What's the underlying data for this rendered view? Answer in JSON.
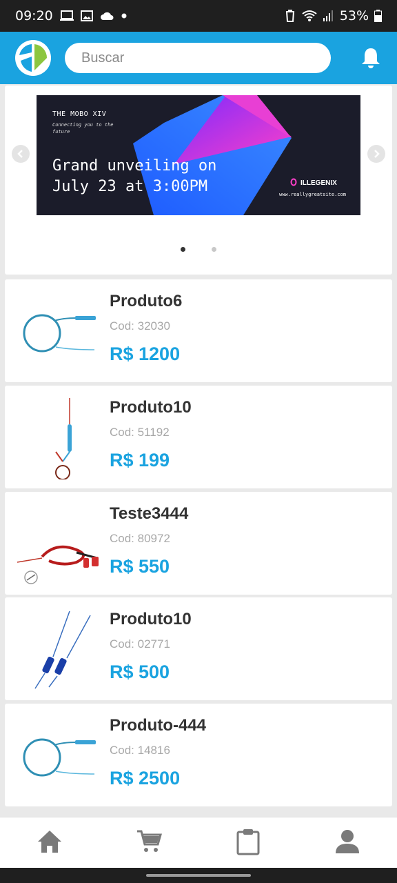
{
  "status": {
    "time": "09:20",
    "battery": "53%"
  },
  "header": {
    "search_placeholder": "Buscar"
  },
  "banner": {
    "title": "THE MOBO XIV",
    "subtitle": "Connecting you to the future",
    "headline": "Grand unveiling on July 23 at 3:00PM",
    "brand": "ILLEGENIX",
    "site": "www.reallygreatsite.com"
  },
  "products": [
    {
      "name": "Produto6",
      "code": "Cod: 32030",
      "price": "R$ 1200"
    },
    {
      "name": "Produto10",
      "code": "Cod: 51192",
      "price": "R$ 199"
    },
    {
      "name": "Teste3444",
      "code": "Cod: 80972",
      "price": "R$ 550"
    },
    {
      "name": "Produto10",
      "code": "Cod: 02771",
      "price": "R$ 500"
    },
    {
      "name": "Produto-444",
      "code": "Cod: 14816",
      "price": "R$ 2500"
    }
  ],
  "tabs": [
    {
      "icon": "home-icon"
    },
    {
      "icon": "cart-icon"
    },
    {
      "icon": "clipboard-icon"
    },
    {
      "icon": "user-icon"
    }
  ],
  "colors": {
    "accent": "#1aa3e0",
    "status_bar": "#1f1f1f",
    "text": "#333333",
    "muted": "#a8a8a8"
  }
}
